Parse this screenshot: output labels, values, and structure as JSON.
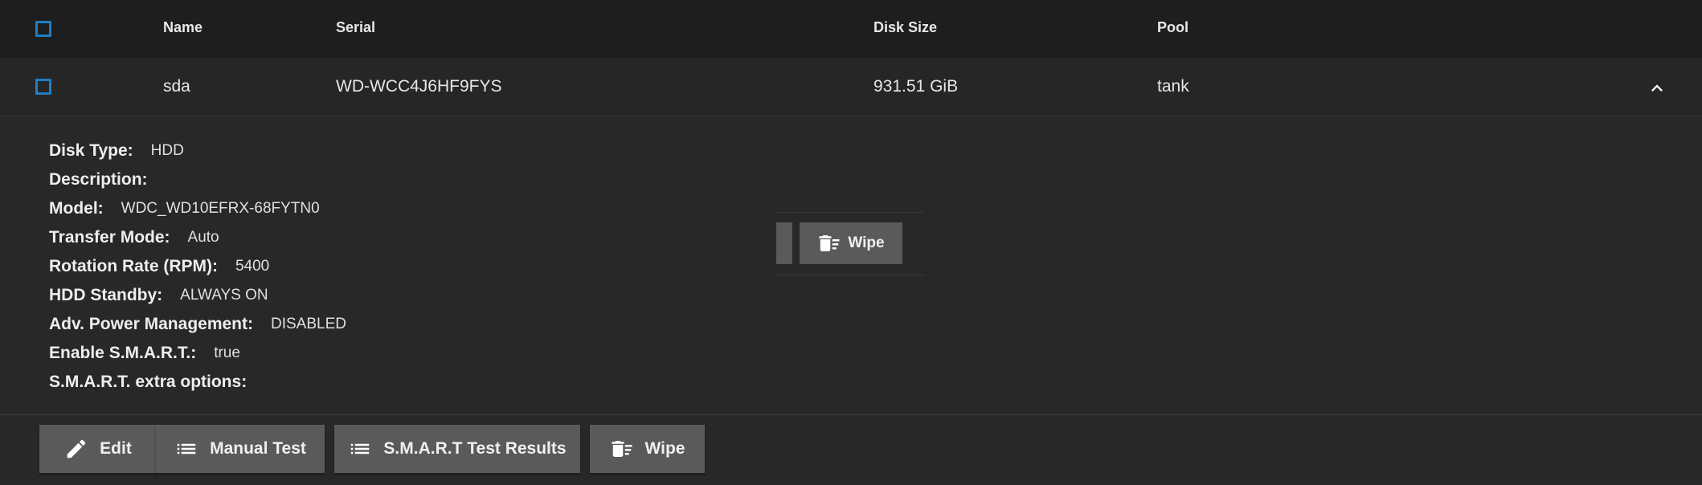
{
  "table": {
    "columns": [
      "Name",
      "Serial",
      "Disk Size",
      "Pool"
    ],
    "row": {
      "name": "sda",
      "serial": "WD-WCC4J6HF9FYS",
      "disk_size": "931.51 GiB",
      "pool": "tank"
    }
  },
  "details": [
    {
      "label": "Disk Type:",
      "value": "HDD"
    },
    {
      "label": "Description:",
      "value": ""
    },
    {
      "label": "Model:",
      "value": "WDC_WD10EFRX-68FYTN0"
    },
    {
      "label": "Transfer Mode:",
      "value": "Auto"
    },
    {
      "label": "Rotation Rate (RPM):",
      "value": "5400"
    },
    {
      "label": "HDD Standby:",
      "value": "ALWAYS ON"
    },
    {
      "label": "Adv. Power Management:",
      "value": "DISABLED"
    },
    {
      "label": "Enable S.M.A.R.T.:",
      "value": "true"
    },
    {
      "label": "S.M.A.R.T. extra options:",
      "value": ""
    }
  ],
  "mini_actions": {
    "wipe_label": "Wipe"
  },
  "actions": {
    "edit_label": "Edit",
    "manual_test_label": "Manual Test",
    "smart_results_label": "S.M.A.R.T Test Results",
    "wipe_label": "Wipe"
  },
  "icons": {
    "checkbox": "checkbox-icon",
    "expand": "chevron-up-icon",
    "edit": "pencil-icon",
    "list": "list-icon",
    "wipe": "delete-sweep-icon"
  },
  "colors": {
    "accent": "#1f7ec4",
    "button_bg": "#5a5a5a",
    "header_bg": "#1e1e1e",
    "page_bg": "#282828"
  }
}
